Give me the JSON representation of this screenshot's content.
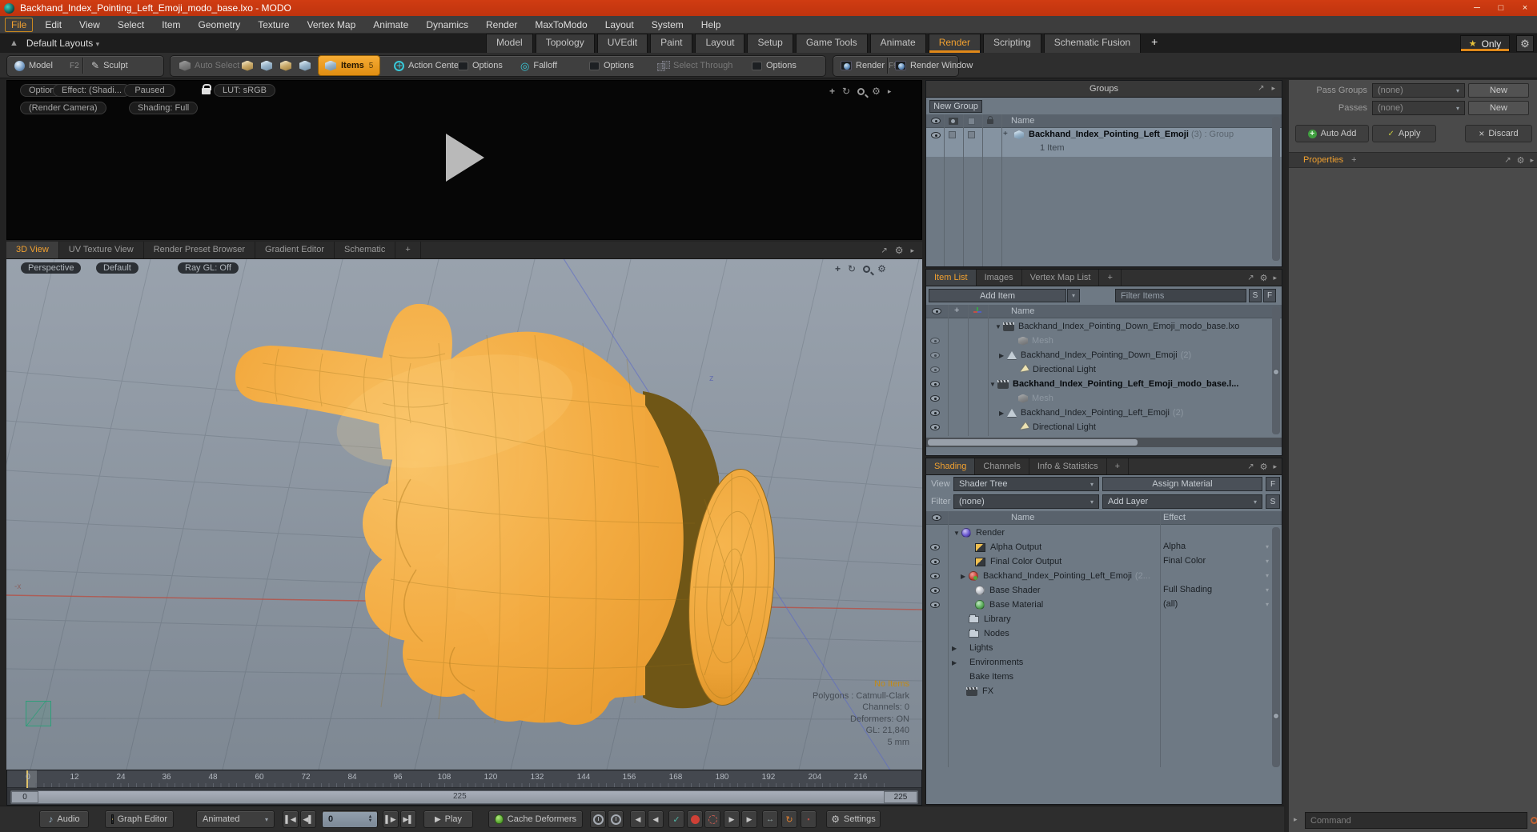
{
  "window": {
    "title": "Backhand_Index_Pointing_Left_Emoji_modo_base.lxo - MODO",
    "minimize": "─",
    "maximize": "□",
    "close": "×"
  },
  "menubar": {
    "items": [
      "File",
      "Edit",
      "View",
      "Select",
      "Item",
      "Geometry",
      "Texture",
      "Vertex Map",
      "Animate",
      "Dynamics",
      "Render",
      "MaxToModo",
      "Layout",
      "System",
      "Help"
    ]
  },
  "layoutbar": {
    "default_layouts": "Default Layouts",
    "tabs": [
      "Model",
      "Topology",
      "UVEdit",
      "Paint",
      "Layout",
      "Setup",
      "Game Tools",
      "Animate",
      "Render",
      "Scripting",
      "Schematic Fusion",
      "+"
    ],
    "only": "Only"
  },
  "toolbar": {
    "model": "Model",
    "model_key": "F2",
    "sculpt": "Sculpt",
    "auto_select": "Auto Select",
    "items": "Items",
    "items_count": "5",
    "action_center": "Action Center",
    "options_a": "Options",
    "falloff": "Falloff",
    "options_b": "Options",
    "select_through": "Select Through",
    "options_c": "Options",
    "render": "Render",
    "render_key": "F9",
    "render_window": "Render Window"
  },
  "preview": {
    "options": "Options",
    "effect": "Effect: (Shadi...",
    "paused": "Paused",
    "lut": "LUT: sRGB",
    "camera": "(Render Camera)",
    "shading_mode": "Shading: Full"
  },
  "viewport_tabs": {
    "t0": "3D View",
    "t1": "UV Texture View",
    "t2": "Render Preset Browser",
    "t3": "Gradient Editor",
    "t4": "Schematic",
    "t5": "+"
  },
  "viewport": {
    "perspective": "Perspective",
    "default": "Default",
    "raygl": "Ray GL: Off",
    "axis_z": "z",
    "axis_x": "-x",
    "info": {
      "no_items": "No Items",
      "polygons": "Polygons : Catmull-Clark",
      "channels": "Channels: 0",
      "deformers": "Deformers: ON",
      "gl": "GL: 21,840",
      "grid_size": "5 mm"
    }
  },
  "timeline": {
    "ticks": [
      "0",
      "12",
      "24",
      "36",
      "48",
      "60",
      "72",
      "84",
      "96",
      "108",
      "120",
      "132",
      "144",
      "156",
      "168",
      "180",
      "192",
      "204",
      "216"
    ],
    "range_start": "0",
    "range_mid": "225",
    "range_end": "225"
  },
  "bottombar": {
    "audio": "Audio",
    "graph_editor": "Graph Editor",
    "animated": "Animated",
    "frame": "0",
    "play": "Play",
    "cache_deformers": "Cache Deformers",
    "settings": "Settings"
  },
  "groups": {
    "title": "Groups",
    "new_group": "New Group",
    "name_header": "Name",
    "row_name": "Backhand_Index_Pointing_Left_Emoji",
    "row_suffix": "(3) : Group",
    "row_sub": "1 Item"
  },
  "item_list": {
    "tabs": {
      "t0": "Item List",
      "t1": "Images",
      "t2": "Vertex Map List",
      "t3": "+"
    },
    "add_item": "Add Item",
    "filter_items": "Filter Items",
    "btn_s": "S",
    "btn_f": "F",
    "name_header": "Name",
    "rows": [
      {
        "label": "Backhand_Index_Pointing_Down_Emoji_modo_base.lxo",
        "count": ""
      },
      {
        "label": "Mesh",
        "count": ""
      },
      {
        "label": "Backhand_Index_Pointing_Down_Emoji",
        "count": "(2)"
      },
      {
        "label": "Directional Light",
        "count": ""
      },
      {
        "label": "Backhand_Index_Pointing_Left_Emoji_modo_base.l...",
        "count": ""
      },
      {
        "label": "Mesh",
        "count": ""
      },
      {
        "label": "Backhand_Index_Pointing_Left_Emoji",
        "count": "(2)"
      },
      {
        "label": "Directional Light",
        "count": ""
      }
    ]
  },
  "shading": {
    "tabs": {
      "t0": "Shading",
      "t1": "Channels",
      "t2": "Info & Statistics",
      "t3": "+"
    },
    "view_label": "View",
    "view_value": "Shader Tree",
    "assign_material": "Assign Material",
    "btn_f": "F",
    "filter_label": "Filter",
    "filter_value": "(none)",
    "add_layer": "Add Layer",
    "btn_s": "S",
    "name_header": "Name",
    "effect_header": "Effect",
    "rows": [
      {
        "label": "Render",
        "count": "",
        "effect": ""
      },
      {
        "label": "Alpha Output",
        "count": "",
        "effect": "Alpha"
      },
      {
        "label": "Final Color Output",
        "count": "",
        "effect": "Final Color"
      },
      {
        "label": "Backhand_Index_Pointing_Left_Emoji",
        "count": "(2...",
        "effect": ""
      },
      {
        "label": "Base Shader",
        "count": "",
        "effect": "Full Shading"
      },
      {
        "label": "Base Material",
        "count": "",
        "effect": "(all)"
      },
      {
        "label": "Library",
        "count": "",
        "effect": ""
      },
      {
        "label": "Nodes",
        "count": "",
        "effect": ""
      },
      {
        "label": "Lights",
        "count": "",
        "effect": ""
      },
      {
        "label": "Environments",
        "count": "",
        "effect": ""
      },
      {
        "label": "Bake Items",
        "count": "",
        "effect": ""
      },
      {
        "label": "FX",
        "count": "",
        "effect": ""
      }
    ]
  },
  "right_panel": {
    "pass_groups": "Pass Groups",
    "passes": "Passes",
    "pass_groups_value": "(none)",
    "passes_value": "(none)",
    "new_a": "New",
    "new_b": "New",
    "auto_add": "Auto Add",
    "apply": "Apply",
    "discard": "Discard",
    "properties": "Properties",
    "plus": "+",
    "command_placeholder": "Command"
  },
  "colors": {
    "accent": "#f0a030",
    "titlebar": "#c83812",
    "viewport_bg": "#8b95a1",
    "hand": "#f0a43c"
  }
}
